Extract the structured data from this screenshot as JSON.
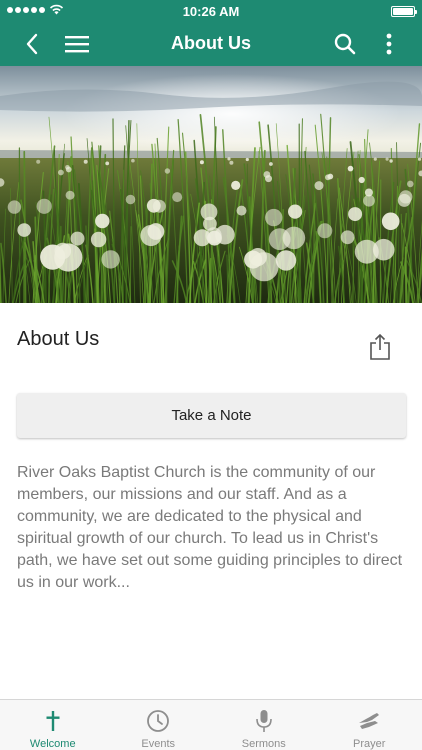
{
  "status_bar": {
    "time": "10:26 AM"
  },
  "nav": {
    "title": "About Us"
  },
  "content": {
    "section_title": "About Us",
    "take_note_label": "Take a Note",
    "description": "River Oaks Baptist Church is the community of our members, our missions and our staff. And as a community, we are dedicated to the physical and spiritual growth of our church. To lead us in Christ's path, we have set out some guiding principles to direct us in our work..."
  },
  "tabs": [
    {
      "label": "Welcome",
      "icon": "cross-icon",
      "active": true
    },
    {
      "label": "Events",
      "icon": "clock-icon",
      "active": false
    },
    {
      "label": "Sermons",
      "icon": "microphone-icon",
      "active": false
    },
    {
      "label": "Prayer",
      "icon": "praying-hands-icon",
      "active": false
    }
  ],
  "colors": {
    "brand": "#1e8a72",
    "inactive": "#8e8e8e",
    "text": "#7a7a7a"
  }
}
